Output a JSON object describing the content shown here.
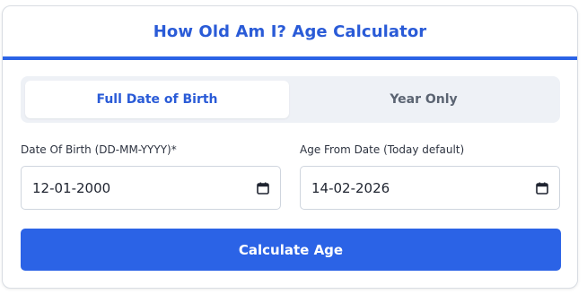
{
  "header": {
    "title": "How Old Am I? Age Calculator"
  },
  "tabs": [
    {
      "label": "Full Date of Birth",
      "active": true
    },
    {
      "label": "Year Only",
      "active": false
    }
  ],
  "form": {
    "dob": {
      "label": "Date Of Birth (DD-MM-YYYY)*",
      "value": "12-01-2000",
      "icon": "calendar-icon"
    },
    "from_date": {
      "label": "Age From Date (Today default)",
      "value": "14-02-2026",
      "icon": "calendar-icon"
    }
  },
  "actions": {
    "calculate_label": "Calculate Age"
  },
  "colors": {
    "accent": "#2b63e6",
    "title": "#2a5bd7",
    "tab_bg": "#eef1f6",
    "inactive_tab_text": "#5b6472"
  }
}
